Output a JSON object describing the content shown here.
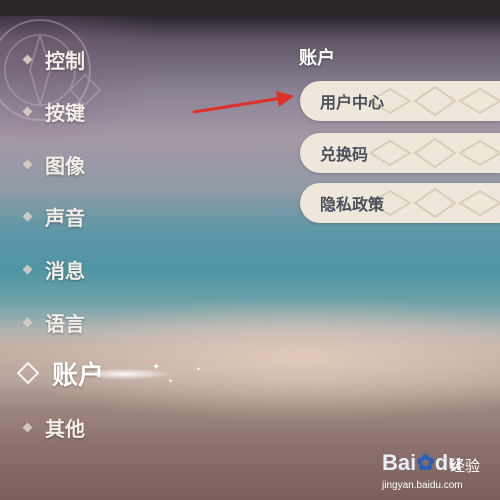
{
  "sidebar": {
    "items": [
      {
        "label": "控制"
      },
      {
        "label": "按键"
      },
      {
        "label": "图像"
      },
      {
        "label": "声音"
      },
      {
        "label": "消息"
      },
      {
        "label": "语言"
      },
      {
        "label": "账户",
        "active": true
      },
      {
        "label": "其他"
      }
    ]
  },
  "account": {
    "title": "账户",
    "buttons": [
      {
        "label": "用户中心"
      },
      {
        "label": "兑换码"
      },
      {
        "label": "隐私政策"
      }
    ]
  },
  "annotation": {
    "arrow_color": "#e0302a",
    "target": "用户中心"
  },
  "watermark": {
    "logo_text": "Bai",
    "logo_suffix": "du",
    "name": "经验",
    "url": "jingyan.baidu.com"
  },
  "colors": {
    "button_bg": "#efe7da",
    "button_text": "#4a4f5c",
    "menu_text": "#f3eee7"
  }
}
